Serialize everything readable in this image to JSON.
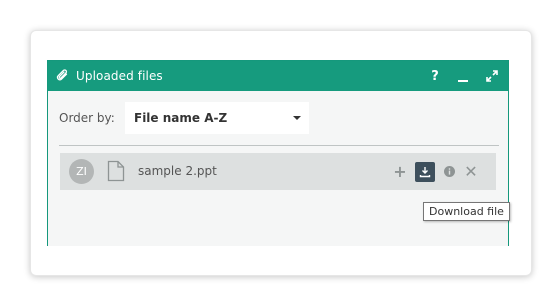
{
  "widget": {
    "title": "Uploaded files",
    "help_label": "?",
    "icons": {
      "attach": "paperclip-icon",
      "help": "help-icon",
      "minimize": "minimize-icon",
      "maximize": "expand-icon"
    },
    "header_color": "#169b7e"
  },
  "order": {
    "label": "Order by:",
    "selected": "File name A-Z"
  },
  "files": [
    {
      "initials": "ZI",
      "name": "sample 2.ppt",
      "actions": {
        "add": "+",
        "remove": "✕"
      }
    }
  ],
  "tooltip": {
    "text": "Download file"
  }
}
